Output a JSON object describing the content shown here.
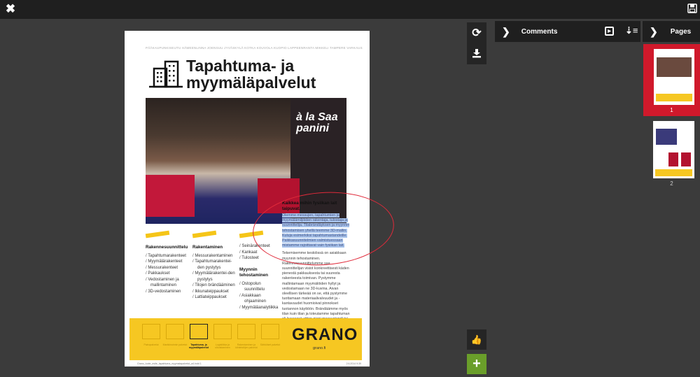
{
  "topbar": {
    "close_icon": "close-icon",
    "save_icon": "save-icon"
  },
  "document": {
    "cities": "PÄÄKAUPUNKISEUTU  HÄMEENLINNA  JOENSUU  JYVÄSKYLÄ  KOTKA  KOUVOLA  KUOPIO  LAPPEENRANTA  MIKKELI  TAMPERE  VARKAUS",
    "title_line1": "Tapahtuma- ja",
    "title_line2": "myymäläpalvelut",
    "photo_sign": "à la Saa panini",
    "columns": [
      {
        "heading": "Rakennesuunnittelu",
        "items": [
          "Tapahtumarakenteet",
          "Myymälärakenteet",
          "Messurakenteet",
          "Pakkaukset",
          "Vedostaminen ja mallintaminen",
          "3D-vedostaminen"
        ]
      },
      {
        "heading": "Rakentaminen",
        "items": [
          "Messurakentaminen",
          "Tapahtumarakentei-den pystytys",
          "Myymälärakentei-den pystytys",
          "Tilojen brändääminen",
          "Ikkunateippaukset",
          "Lattiateippaukset"
        ]
      },
      {
        "heading": "",
        "items": [
          "Seinärakenteet",
          "Kankaat",
          "Tulosteet"
        ],
        "heading2": "Myynnin tehostaminen",
        "items2": [
          "Ostopolun suunnittelu",
          "Asiakkaan ohjaaminen",
          "Myymäläanalytiikka"
        ]
      }
    ],
    "text_heading": "Kaikkea mihin fysiikan lait taipuvat.",
    "text_highlighted": "Olemme messujen, tapahtumien ja myymälämiljöiden rakentaja, tulostaja ja suunnittelija. Tilabrändäyksen ja myynnin tehostamisen yhellä teemme 3D-mallin. Kuluja esimerkiksi tapahtumastandeille. Paikkasuunnitelmien valmistuessaan mistamme rajoittavat vain fysiikan lait.",
    "text_body": "Tekemisemme keskiössä on asiakkaan myynnin tehostaminen. Rakennesuunnittelumme saa suunnittelijan visiot konkreettisesti käden pienestä pakkauksesta tai suuresta rakenteesta toimivan. Pystymme mallintamaan myymälöiden hyllyt ja vedostamaan ne 3D-kuvina. Aivan oleellisen tärkeää on se, että pystymme tuottamaan materiaalivalvuudet ja -kantavuudet huomioivat pinnokset tuotannon käyttöön. Brändäämme myös tilan kuin tilan ja toteutamme tapahtuman oli kyseessä sitten pieni messustandi tai Jukolan Viesti.",
    "footer_services": [
      "Painopalvelut",
      "Markkinoinnin palvelut",
      "Tapahtuma- ja myymäläpalvelut",
      "Logistiikka ja ulkoistaminen",
      "Rakentaminen ja kiinteistöjen palvelut",
      "Sähköiset palvelut"
    ],
    "logo_text": "GRANO",
    "logo_url": "grano.fi",
    "page_footer_left": "Grano_tuote_esite_tapahtuma_myymalapalvelut_a4.indd   1",
    "page_footer_right": "2.6.2014   9:39"
  },
  "toolbar": {
    "rotate_icon": "rotate-icon",
    "download_icon": "download-icon",
    "like_icon": "thumbs-up-icon",
    "add_icon": "plus-icon"
  },
  "comments_panel": {
    "title": "Comments",
    "play_icon": "play-icon",
    "sort_icon": "sort-icon"
  },
  "pages_panel": {
    "title": "Pages",
    "pages": [
      {
        "label": "1",
        "selected": true
      },
      {
        "label": "2",
        "selected": false
      }
    ]
  },
  "colors": {
    "accent_red": "#d0192b",
    "add_green": "#6a9e2a",
    "brand_yellow": "#f6c722",
    "highlight": "#a9c4ec"
  }
}
